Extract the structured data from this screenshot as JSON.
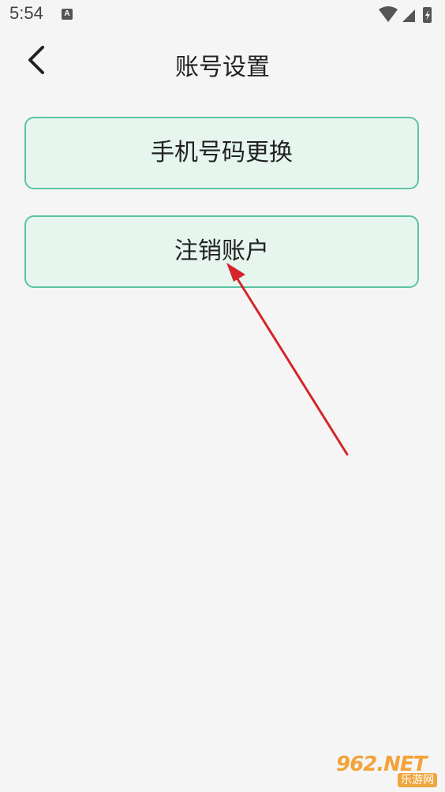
{
  "status_bar": {
    "time": "5:54",
    "notification_icon": "a-icon"
  },
  "header": {
    "title": "账号设置",
    "back_icon": "chevron-left-icon"
  },
  "buttons": {
    "change_phone": "手机号码更换",
    "delete_account": "注销账户"
  },
  "watermark": {
    "brand": "962.NET",
    "tagline": "乐游网"
  },
  "colors": {
    "button_bg": "#e6f6ee",
    "button_border": "#5cc3a2",
    "arrow": "#d3252b"
  }
}
